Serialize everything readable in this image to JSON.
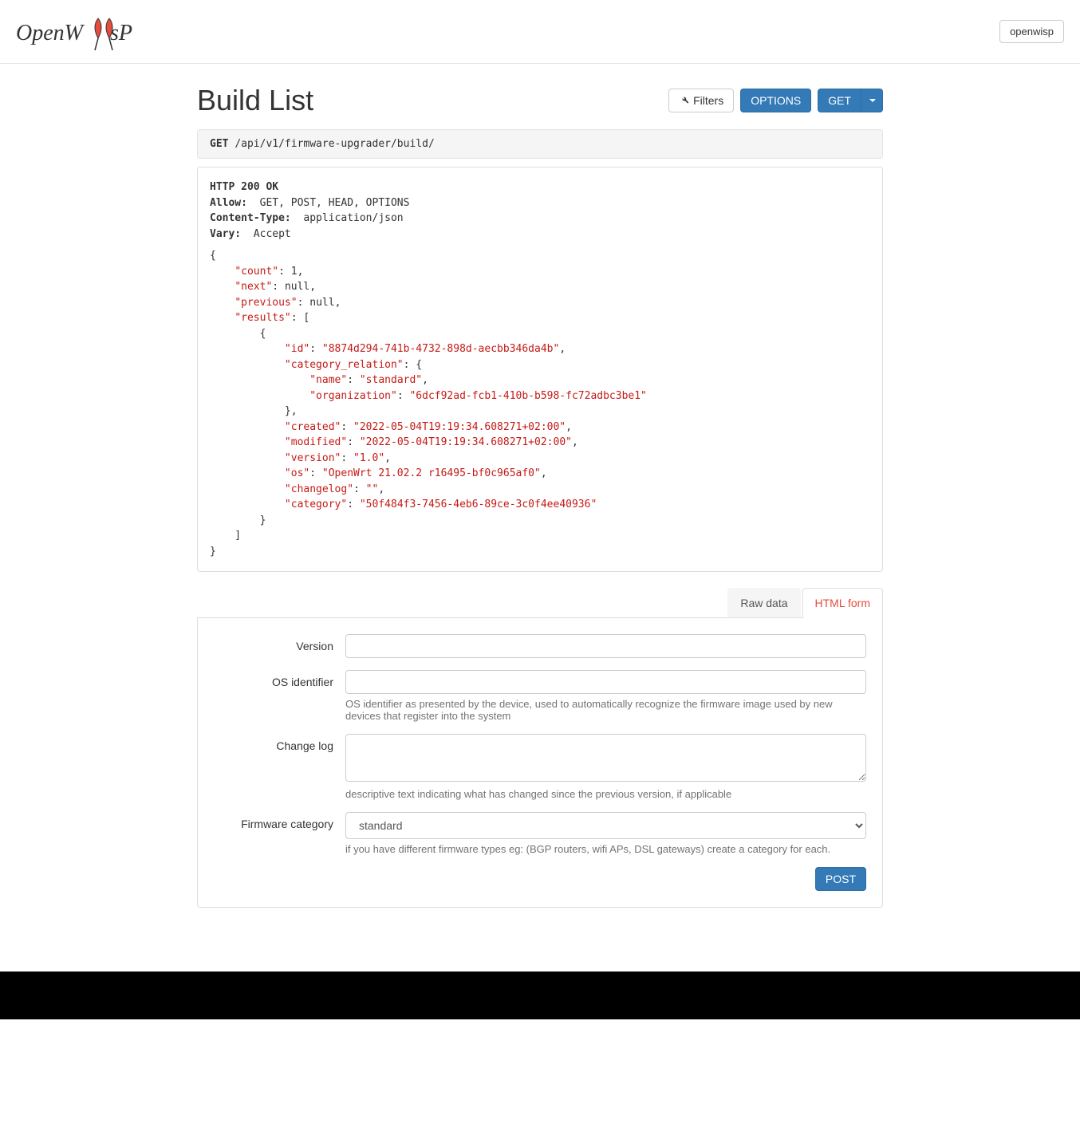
{
  "navbar": {
    "user_label": "openwisp"
  },
  "header": {
    "title": "Build List",
    "filters_label": "Filters",
    "options_label": "OPTIONS",
    "get_label": "GET"
  },
  "request": {
    "method": "GET",
    "path": "/api/v1/firmware-upgrader/build/"
  },
  "response": {
    "status_line": "HTTP 200 OK",
    "headers": [
      {
        "name": "Allow:",
        "value": "GET, POST, HEAD, OPTIONS"
      },
      {
        "name": "Content-Type:",
        "value": "application/json"
      },
      {
        "name": "Vary:",
        "value": "Accept"
      }
    ],
    "body": {
      "count": 1,
      "next": null,
      "previous": null,
      "results": [
        {
          "id": "8874d294-741b-4732-898d-aecbb346da4b",
          "category_relation": {
            "name": "standard",
            "organization": "6dcf92ad-fcb1-410b-b598-fc72adbc3be1"
          },
          "created": "2022-05-04T19:19:34.608271+02:00",
          "modified": "2022-05-04T19:19:34.608271+02:00",
          "version": "1.0",
          "os": "OpenWrt 21.02.2 r16495-bf0c965af0",
          "changelog": "",
          "category": "50f484f3-7456-4eb6-89ce-3c0f4ee40936"
        }
      ]
    }
  },
  "tabs": {
    "raw_data": "Raw data",
    "html_form": "HTML form"
  },
  "form": {
    "version": {
      "label": "Version",
      "value": ""
    },
    "os": {
      "label": "OS identifier",
      "value": "",
      "help": "OS identifier as presented by the device, used to automatically recognize the firmware image used by new devices that register into the system"
    },
    "changelog": {
      "label": "Change log",
      "value": "",
      "help": "descriptive text indicating what has changed since the previous version, if applicable"
    },
    "category": {
      "label": "Firmware category",
      "selected": "standard",
      "help": "if you have different firmware types eg: (BGP routers, wifi APs, DSL gateways) create a category for each."
    },
    "submit_label": "POST"
  }
}
